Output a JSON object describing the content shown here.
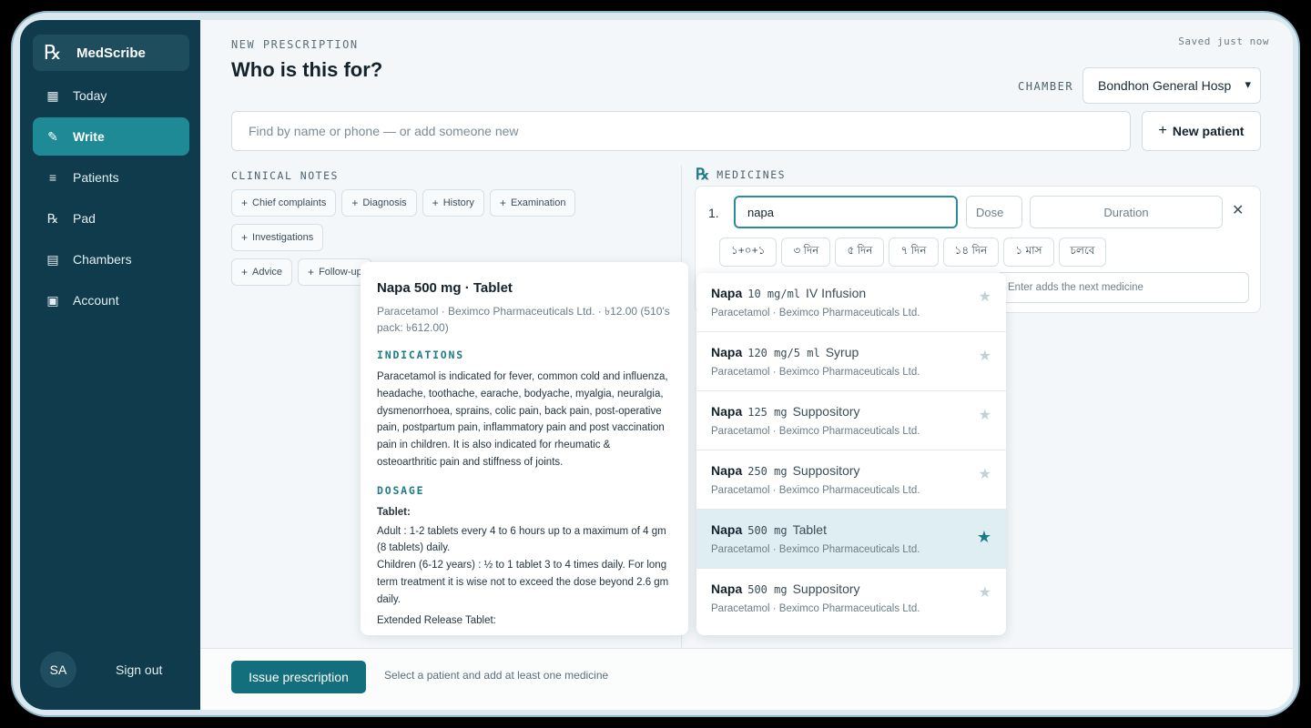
{
  "sidebar": {
    "brand": {
      "icon": "℞",
      "name": "MedScribe"
    },
    "items": [
      {
        "label": "Today",
        "icon": "▦"
      },
      {
        "label": "Write",
        "icon": "✎",
        "active": true
      },
      {
        "label": "Patients",
        "icon": "≡"
      },
      {
        "label": "Pad",
        "icon": "℞"
      },
      {
        "label": "Chambers",
        "icon": "▤"
      },
      {
        "label": "Account",
        "icon": "▣"
      }
    ],
    "user_initials": "SA",
    "sign_out": "Sign out"
  },
  "header": {
    "eyebrow": "NEW PRESCRIPTION",
    "title": "Who is this for?",
    "saved_status": "Saved just now",
    "chamber_label": "CHAMBER",
    "chamber_value": "Bondhon General Hosp"
  },
  "search": {
    "placeholder": "Find by name or phone — or add someone new",
    "new_patient_label": "New patient"
  },
  "clinical_notes": {
    "label": "CLINICAL NOTES",
    "chips": [
      "Chief complaints",
      "Diagnosis",
      "History",
      "Examination",
      "Investigations",
      "Advice",
      "Follow-up"
    ]
  },
  "medicines": {
    "rx_icon": "℞",
    "label": "MEDICINES",
    "row_number": "1.",
    "medicine_value": "napa",
    "dose_placeholder": "Dose",
    "duration_placeholder": "Duration",
    "duration_chips": [
      "১+০+১",
      "৩ দিন",
      "৫ দিন",
      "৭ দিন",
      "১৪ দিন",
      "১ মাস",
      "চলবে"
    ],
    "hint_placeholder": "Enter adds the next medicine"
  },
  "detail": {
    "title": "Napa 500 mg · Tablet",
    "subtitle": "Paracetamol · Beximco Pharmaceuticals Ltd. · ৳12.00 (510's pack: ৳612.00)",
    "indications_heading": "INDICATIONS",
    "indications_text": "Paracetamol is indicated for fever, common cold and influenza, headache, toothache, earache, bodyache, myalgia, neuralgia, dysmenorrhoea, sprains, colic pain, back pain, post-operative pain, postpartum pain, inflammatory pain and post vaccination pain in children. It is also indicated for rheumatic & osteoarthritic pain and stiffness of joints.",
    "dosage_heading": "DOSAGE",
    "dosage_subheading": "Tablet:",
    "dosage_text": "Adult : 1-2 tablets every 4 to 6 hours up to a maximum of 4 gm (8 tablets) daily.\nChildren (6-12 years) : ½ to 1 tablet 3 to 4 times daily. For long term treatment it is wise not to exceed the dose beyond 2.6 gm daily.",
    "extended_heading": "Extended Release Tablet:"
  },
  "suggestions": [
    {
      "name": "Napa",
      "strength": "10 mg/ml",
      "form": "IV Infusion",
      "generic": "Paracetamol · Beximco Pharmaceuticals Ltd.",
      "starred": false
    },
    {
      "name": "Napa",
      "strength": "120 mg/5 ml",
      "form": "Syrup",
      "generic": "Paracetamol · Beximco Pharmaceuticals Ltd.",
      "starred": false
    },
    {
      "name": "Napa",
      "strength": "125 mg",
      "form": "Suppository",
      "generic": "Paracetamol · Beximco Pharmaceuticals Ltd.",
      "starred": false
    },
    {
      "name": "Napa",
      "strength": "250 mg",
      "form": "Suppository",
      "generic": "Paracetamol · Beximco Pharmaceuticals Ltd.",
      "starred": false
    },
    {
      "name": "Napa",
      "strength": "500 mg",
      "form": "Tablet",
      "generic": "Paracetamol · Beximco Pharmaceuticals Ltd.",
      "starred": true
    },
    {
      "name": "Napa",
      "strength": "500 mg",
      "form": "Suppository",
      "generic": "Paracetamol · Beximco Pharmaceuticals Ltd.",
      "starred": false
    }
  ],
  "footer": {
    "issue_label": "Issue prescription",
    "hint": "Select a patient and add at least one medicine"
  },
  "colors": {
    "sidebar": "#0f3b4c",
    "accent": "#1d8a96",
    "primary_button": "#146f7c"
  }
}
